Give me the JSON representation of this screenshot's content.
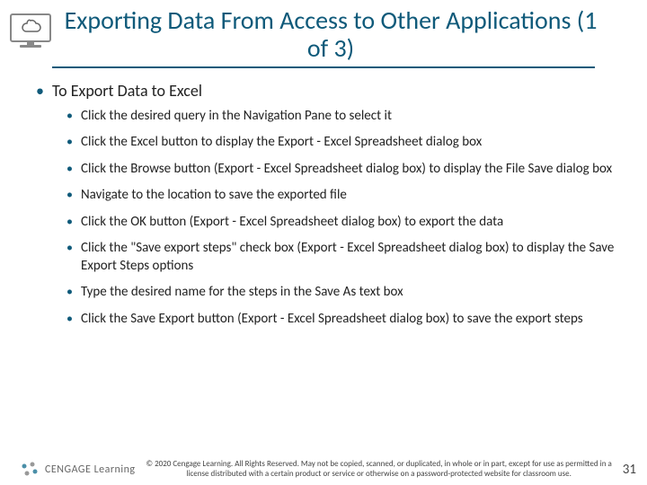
{
  "title": "Exporting Data From Access to Other Applications (1 of 3)",
  "subheading": "To Export Data to Excel",
  "steps": [
    "Click the desired query in the Navigation Pane to select it",
    "Click the Excel button to display the Export - Excel Spreadsheet dialog box",
    "Click the Browse button (Export - Excel Spreadsheet dialog box) to display the File Save dialog box",
    "Navigate to the location to save the exported file",
    "Click the OK button (Export - Excel Spreadsheet dialog box) to export the data",
    "Click the \"Save export steps\" check box (Export - Excel Spreadsheet dialog box) to display the Save Export Steps options",
    "Type the desired name for the steps in the Save As text box",
    "Click the Save Export button (Export - Excel Spreadsheet dialog box) to save the export steps"
  ],
  "logo_text": "CENGAGE Learning",
  "copyright": "© 2020 Cengage Learning. All Rights Reserved. May not be copied, scanned, or duplicated, in whole or in part, except for use as permitted in a license distributed with a certain product or service or otherwise on a password-protected website for classroom use.",
  "page_number": "31"
}
